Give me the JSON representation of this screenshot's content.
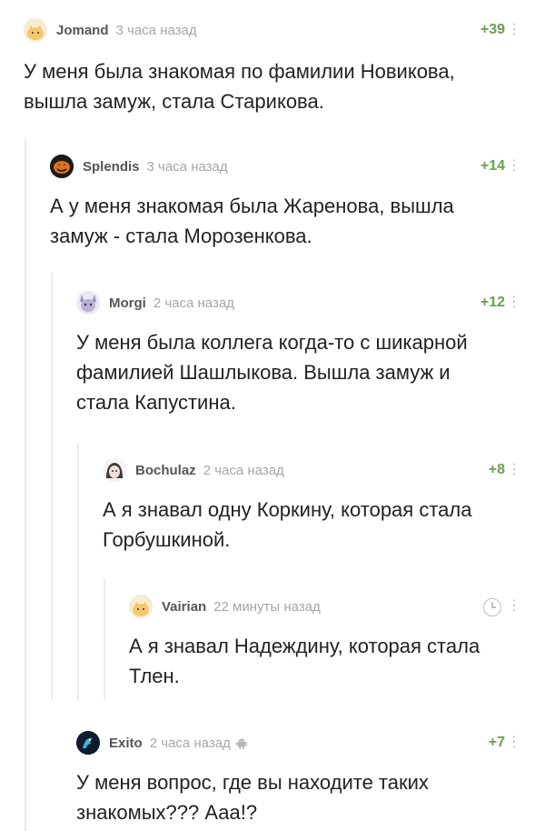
{
  "comments": [
    {
      "user": "Jomand",
      "time": "3 часа назад",
      "rating": "+39",
      "text_lines": [
        "У меня была знакомая по фамилии Новикова,",
        "вышла замуж, стала Старикова."
      ]
    },
    {
      "user": "Splendis",
      "time": "3 часа назад",
      "rating": "+14",
      "text_lines": [
        "А у меня знакомая была Жаренова, вышла",
        "замуж - стала Морозенкова."
      ]
    },
    {
      "user": "Morgi",
      "time": "2 часа назад",
      "rating": "+12",
      "text_lines": [
        "У меня была коллега когда-то с шикарной",
        "фамилией Шашлыкова. Вышла замуж и",
        "стала Капустина."
      ]
    },
    {
      "user": "Bochulaz",
      "time": "2 часа назад",
      "rating": "+8",
      "text_lines": [
        "А я знавал одну Коркину, которая стала",
        "Горбушкиной."
      ]
    },
    {
      "user": "Vairian",
      "time": "22 минуты назад",
      "rating": "",
      "text_lines": [
        "А я знавал Надеждину, которая стала",
        "Тлен."
      ]
    },
    {
      "user": "Exito",
      "time": "2 часа назад",
      "rating": "+7",
      "text_lines": [
        "У меня вопрос, где вы находите таких",
        "знакомых??? Ааа!?"
      ]
    }
  ],
  "menu_glyph": "⋮",
  "icons": {
    "clock": "clock-icon",
    "android": "android-icon"
  },
  "colors": {
    "rating": "#6aa04e",
    "time": "#a6a6a6",
    "thread_line": "#ececec"
  }
}
